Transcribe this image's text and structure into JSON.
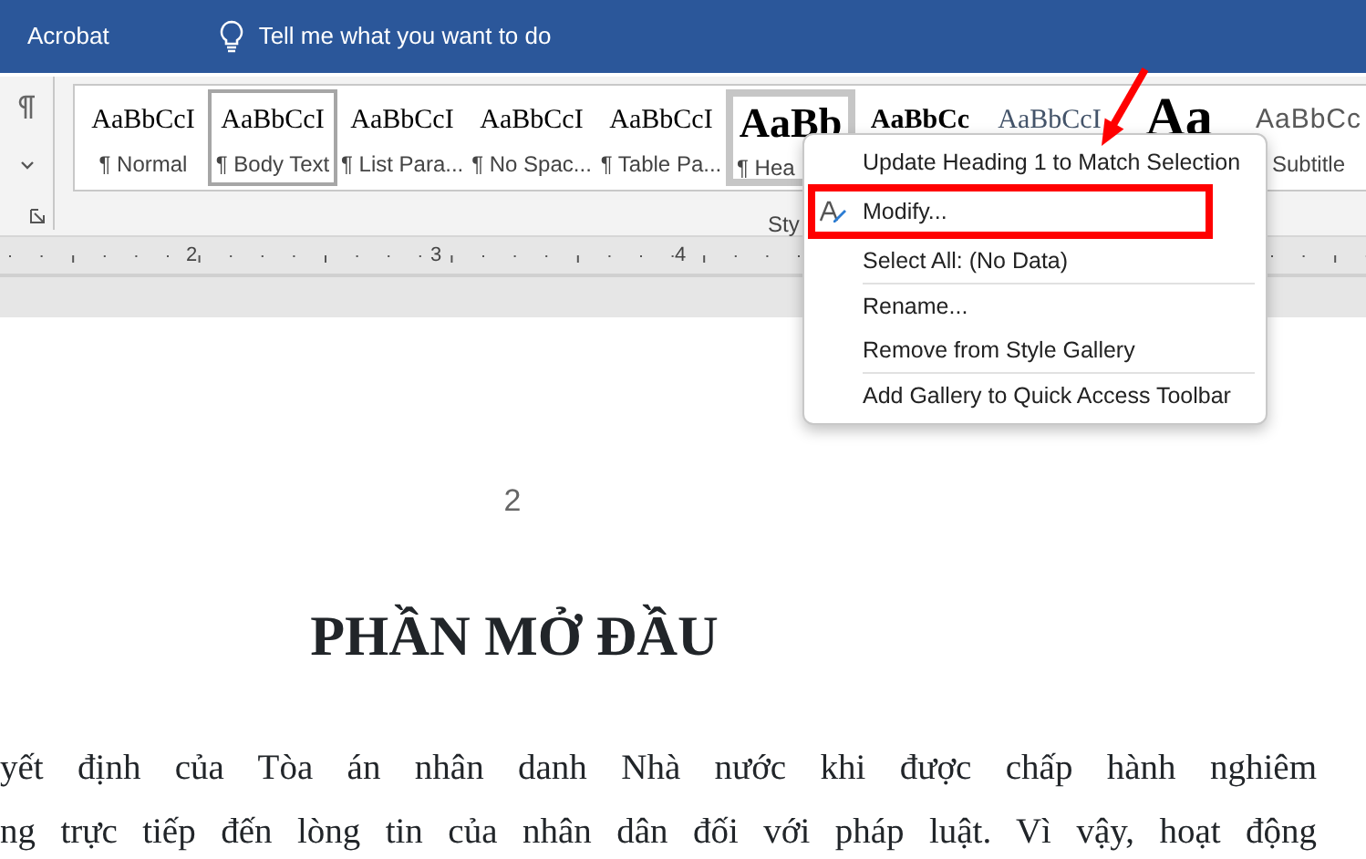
{
  "title_bar": {
    "tab": "Acrobat",
    "search_prompt": "Tell me what you want to do"
  },
  "styles_gallery": {
    "items": [
      {
        "preview": "AaBbCcI",
        "label": "¶ Normal",
        "kind": "normal",
        "selected": false,
        "hovered": false
      },
      {
        "preview": "AaBbCcI",
        "label": "¶ Body Text",
        "kind": "normal",
        "selected": false,
        "hovered": true
      },
      {
        "preview": "AaBbCcI",
        "label": "¶ List Para...",
        "kind": "normal",
        "selected": false,
        "hovered": false
      },
      {
        "preview": "AaBbCcI",
        "label": "¶ No Spac...",
        "kind": "normal",
        "selected": false,
        "hovered": false
      },
      {
        "preview": "AaBbCcI",
        "label": "¶ Table Pa...",
        "kind": "normal",
        "selected": false,
        "hovered": false
      },
      {
        "preview": "AaBb",
        "label": "¶ Hea",
        "kind": "heading",
        "selected": true,
        "hovered": false
      },
      {
        "preview": "AaBbCc",
        "kind": "bold",
        "selected": false,
        "hovered": false
      },
      {
        "preview": "AaBbCcI",
        "kind": "blue",
        "selected": false,
        "hovered": false
      },
      {
        "preview": "Aa",
        "kind": "title",
        "selected": false,
        "hovered": false
      },
      {
        "preview": "AaBbCc",
        "label": "Subtitle",
        "kind": "subtitle",
        "selected": false,
        "hovered": false
      }
    ],
    "group_label": "Sty"
  },
  "ruler": {
    "numbers": [
      "2",
      "3",
      "4"
    ]
  },
  "context_menu": [
    {
      "label": "Update Heading 1 to Match Selection",
      "icon": false,
      "separator_before": false
    },
    {
      "label": "Modify...",
      "icon": true,
      "separator_before": false
    },
    {
      "label": "Select All: (No Data)",
      "icon": false,
      "separator_before": false
    },
    {
      "label": "Rename...",
      "icon": false,
      "separator_before": true
    },
    {
      "label": "Remove from Style Gallery",
      "icon": false,
      "separator_before": false
    },
    {
      "label": "Add Gallery to Quick Access Toolbar",
      "icon": false,
      "separator_before": true
    }
  ],
  "document": {
    "page_number": "2",
    "heading": "PHẦN MỞ ĐẦU",
    "lines": [
      "yết định của Tòa án nhân danh Nhà nước khi được chấp hành nghiêm",
      "ng trực tiếp đến lòng tin của nhân dân đối với pháp luật. Vì vậy, hoạt động"
    ]
  }
}
